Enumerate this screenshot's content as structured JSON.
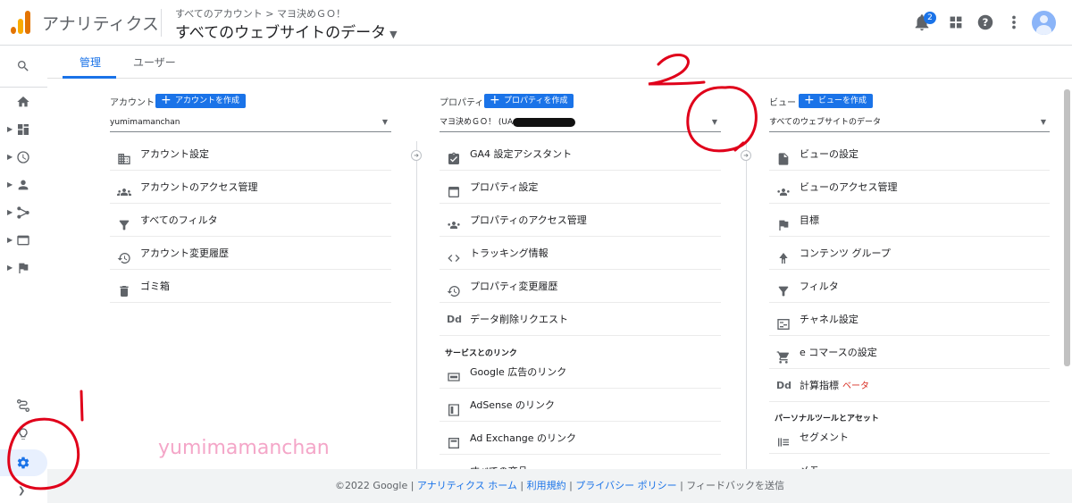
{
  "header": {
    "app_name": "アナリティクス",
    "breadcrumb": "すべてのアカウント > マヨ決めＧＯ！",
    "view_title": "すべてのウェブサイトのデータ",
    "notification_count": "2"
  },
  "tabs": [
    {
      "label": "管理"
    },
    {
      "label": "ユーザー"
    }
  ],
  "account": {
    "heading": "アカウント",
    "create_label": "アカウントを作成",
    "selected": "yumimamanchan",
    "items": [
      {
        "label": "アカウント設定",
        "icon": "building-icon"
      },
      {
        "label": "アカウントのアクセス管理",
        "icon": "people-icon"
      },
      {
        "label": "すべてのフィルタ",
        "icon": "filter-icon"
      },
      {
        "label": "アカウント変更履歴",
        "icon": "history-icon"
      },
      {
        "label": "ゴミ箱",
        "icon": "trash-icon"
      }
    ]
  },
  "property": {
    "heading": "プロパティ",
    "create_label": "プロパティを作成",
    "selected": "マヨ決めＧＯ！ (UA",
    "items": [
      {
        "label": "GA4 設定アシスタント",
        "icon": "checklist-icon"
      },
      {
        "label": "プロパティ設定",
        "icon": "layout-icon"
      },
      {
        "label": "プロパティのアクセス管理",
        "icon": "people-icon"
      },
      {
        "label": "トラッキング情報",
        "icon": "code-icon"
      },
      {
        "label": "プロパティ変更履歴",
        "icon": "history-icon"
      },
      {
        "label": "データ削除リクエスト",
        "icon": "dd-icon"
      }
    ],
    "links_heading": "サービスとのリンク",
    "links": [
      {
        "label": "Google 広告のリンク",
        "icon": "ads-icon"
      },
      {
        "label": "AdSense のリンク",
        "icon": "adsense-icon"
      },
      {
        "label": "Ad Exchange のリンク",
        "icon": "adexchange-icon"
      },
      {
        "label": "すべての商品",
        "icon": "products-icon"
      }
    ]
  },
  "view": {
    "heading": "ビュー",
    "create_label": "ビューを作成",
    "selected": "すべてのウェブサイトのデータ",
    "items": [
      {
        "label": "ビューの設定",
        "icon": "document-icon"
      },
      {
        "label": "ビューのアクセス管理",
        "icon": "people-icon"
      },
      {
        "label": "目標",
        "icon": "flag-icon"
      },
      {
        "label": "コンテンツ グループ",
        "icon": "content-group-icon"
      },
      {
        "label": "フィルタ",
        "icon": "filter-icon"
      },
      {
        "label": "チャネル設定",
        "icon": "channel-icon"
      },
      {
        "label": "e コマースの設定",
        "icon": "cart-icon"
      },
      {
        "label": "計算指標",
        "icon": "dd-icon",
        "badge": "ベータ"
      }
    ],
    "tools_heading": "パーソナルツールとアセット",
    "tools": [
      {
        "label": "セグメント",
        "icon": "segment-icon"
      },
      {
        "label": "メモ",
        "icon": "notes-icon"
      }
    ]
  },
  "watermark": "yumimamanchan",
  "footer": {
    "copyright": "©2022 Google",
    "sep": " | ",
    "home": "アナリティクス ホーム",
    "terms": "利用規約",
    "privacy": "プライバシー ポリシー",
    "feedback": "フィードバックを送信"
  },
  "annotations": {
    "mark_1": "1",
    "mark_2": "2",
    "color": "#e0001a"
  }
}
